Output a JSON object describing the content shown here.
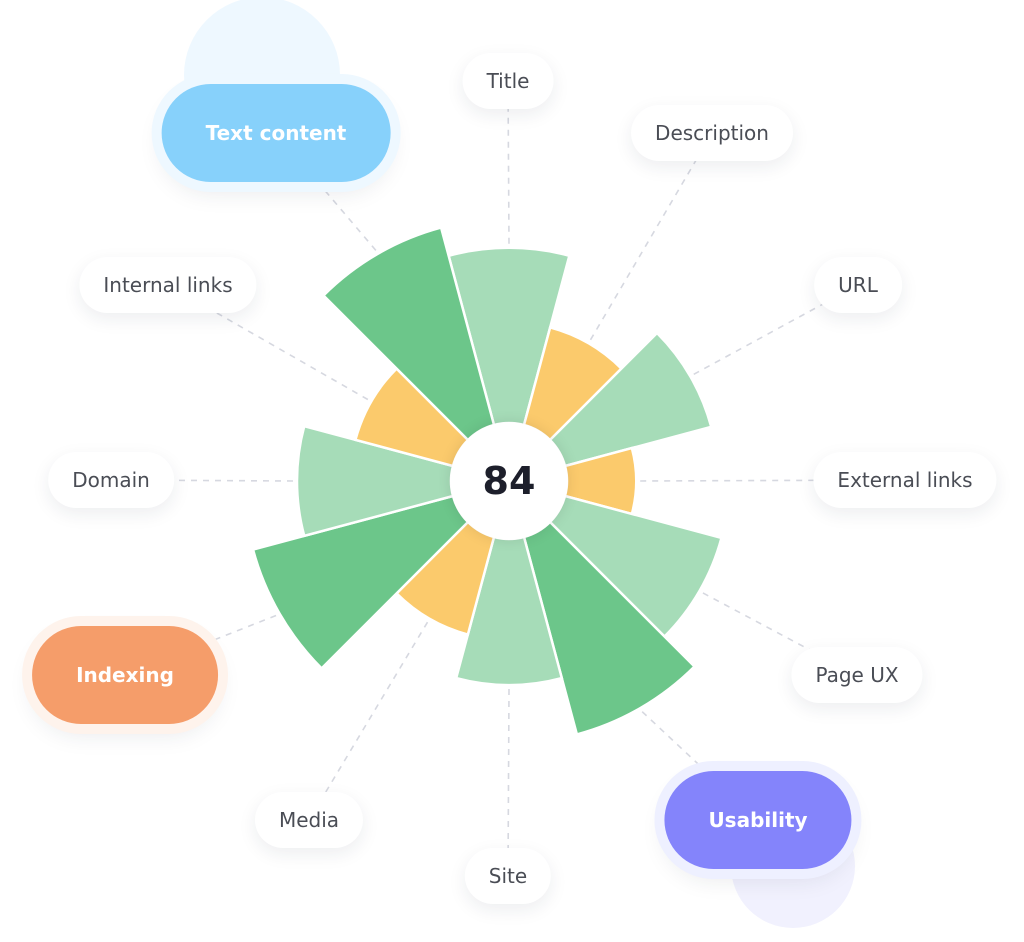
{
  "chart_data": {
    "type": "polar-bar",
    "title": "",
    "score": "84",
    "value_max": 100,
    "start": "top",
    "direction": "clockwise",
    "colors": {
      "good": "#6cc68a",
      "fair": "#a6dcb8",
      "warn": "#fbca6c",
      "connector": "#d6d8e0"
    },
    "categories": [
      {
        "label": "Title",
        "value": 88,
        "status": "fair"
      },
      {
        "label": "Description",
        "value": 60,
        "status": "warn"
      },
      {
        "label": "URL",
        "value": 79,
        "status": "fair"
      },
      {
        "label": "External links",
        "value": 48,
        "status": "warn"
      },
      {
        "label": "Page UX",
        "value": 83,
        "status": "fair"
      },
      {
        "label": "Usability",
        "value": 99,
        "status": "good",
        "highlight": "#8484fb",
        "halo": "#eef0ff"
      },
      {
        "label": "Site",
        "value": 77,
        "status": "fair"
      },
      {
        "label": "Media",
        "value": 60,
        "status": "warn"
      },
      {
        "label": "Indexing",
        "value": 100,
        "status": "good",
        "highlight": "#f59d6a",
        "halo": "#fef3ec"
      },
      {
        "label": "Domain",
        "value": 80,
        "status": "fair"
      },
      {
        "label": "Internal links",
        "value": 60,
        "status": "warn"
      },
      {
        "label": "Text content",
        "value": 99,
        "status": "good",
        "highlight": "#87d1fb",
        "halo": "#eef8ff"
      }
    ]
  },
  "decor": {
    "top_circle_color": "#eef8ff",
    "bottom_circle_color": "#f1f1fe"
  }
}
